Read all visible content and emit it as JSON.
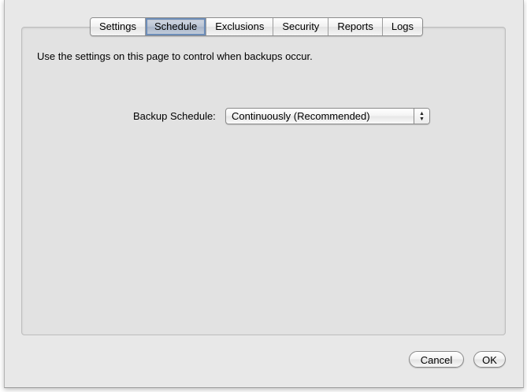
{
  "tabs": [
    {
      "label": "Settings",
      "selected": false
    },
    {
      "label": "Schedule",
      "selected": true
    },
    {
      "label": "Exclusions",
      "selected": false
    },
    {
      "label": "Security",
      "selected": false
    },
    {
      "label": "Reports",
      "selected": false
    },
    {
      "label": "Logs",
      "selected": false
    }
  ],
  "panel": {
    "description": "Use the settings on this page to control when backups occur.",
    "schedule_label": "Backup Schedule:",
    "schedule_value": "Continuously (Recommended)"
  },
  "buttons": {
    "cancel": "Cancel",
    "ok": "OK"
  },
  "icons": {
    "popup_arrows": "up-down-arrows-icon"
  }
}
